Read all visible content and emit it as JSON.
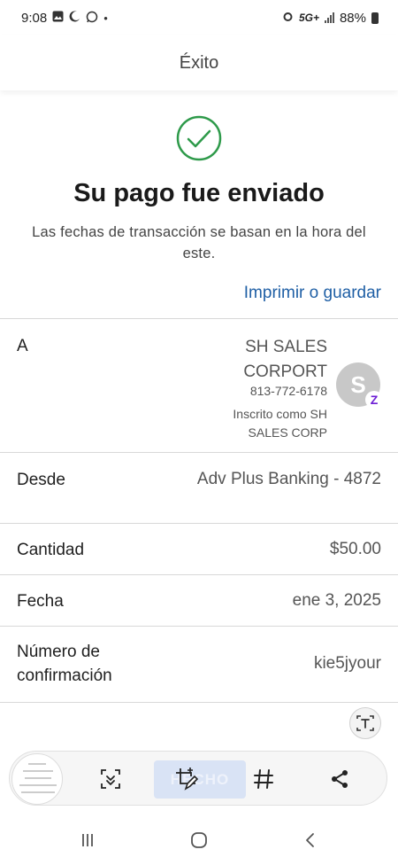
{
  "status_bar": {
    "time": "9:08",
    "network": "5G+",
    "battery": "88%"
  },
  "header": {
    "title": "Éxito"
  },
  "success": {
    "headline": "Su pago fue enviado",
    "subtext": "Las fechas de transacción se basan en la hora del este.",
    "print_link": "Imprimir o guardar"
  },
  "recipient": {
    "label": "A",
    "name": "SH SALES CORPORT",
    "phone": "813-772-6178",
    "enrolled_as": "Inscrito como SH SALES CORP",
    "avatar_initial": "S",
    "badge": "Z"
  },
  "rows": {
    "from": {
      "label": "Desde",
      "value": "Adv Plus Banking - 4872"
    },
    "amount": {
      "label": "Cantidad",
      "value": "$50.00"
    },
    "date": {
      "label": "Fecha",
      "value": "ene 3, 2025"
    },
    "confirmation": {
      "label": "Número de confirmación",
      "value": "kie5jyour"
    }
  },
  "capture_toolbar": {
    "done_label": "HECHO",
    "icons": [
      "scroll-capture-icon",
      "crop-edit-icon",
      "hashtag-icon",
      "share-icon"
    ]
  },
  "colors": {
    "accent_link": "#1f5fa5",
    "success_green": "#2e9a4a",
    "zelle_purple": "#6d1ed4"
  }
}
